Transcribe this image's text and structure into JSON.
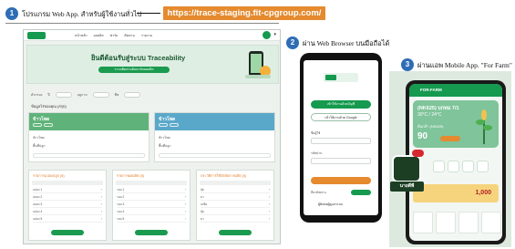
{
  "steps": [
    {
      "number": "1",
      "text": "โปรแกรม Web App. สำหรับผู้ใช้งานทั่วไป"
    },
    {
      "number": "2",
      "text": "ผ่าน Web Browser บนมือถือได้"
    },
    {
      "number": "3",
      "text": "ผ่านแอพ Mobile App. \"For Farm\""
    }
  ],
  "url": "https://trace-staging.fit-cpgroup.com/",
  "desktop": {
    "nav": [
      "หน้าหลัก",
      "ผลผลิต",
      "ฟาร์ม",
      "ติดตาม",
      "รายงาน"
    ],
    "welcome": "ยินดีต้อนรับสู่ระบบ Traceability",
    "banner_button": "ระบบติดตามย้อนกลับผลผลิต",
    "filter_labels": [
      "ตัวกรอง",
      "ปี",
      "ฤดูกาล",
      "พืช"
    ],
    "subtitle": "ข้อมูลไร่ของคุณ (สรุป)",
    "cards": [
      {
        "title": "ข้าวโพด",
        "color": "#5fb37a",
        "line1": "ข้าวโพด",
        "line2": "พื้นที่ปลูก"
      },
      {
        "title": "ข้าวโพด",
        "color": "#5aa8c9",
        "line1": "ข้าวโพด",
        "line2": "พื้นที่ปลูก"
      }
    ],
    "tables": [
      {
        "title": "รายการแปลงปลูก (5)",
        "rows": [
          "แปลง 1",
          "แปลง 2",
          "แปลง 3",
          "แปลง 4",
          "แปลง 5"
        ]
      },
      {
        "title": "รายการผลผลิต (5)",
        "rows": [
          "รอบ 1",
          "รอบ 2",
          "รอบ 3",
          "รอบ 4",
          "รอบ 5"
        ]
      },
      {
        "title": "ประวัติการใช้ปัจจัยการผลิต (5)",
        "rows": [
          "ปุ๋ย",
          "ยา",
          "เมล็ด",
          "ปุ๋ย",
          "ยา"
        ]
      }
    ]
  },
  "phone": {
    "green_button": "เข้าใช้งานด้วยบัญชี",
    "outline_button": "เข้าใช้งานด้วย Google",
    "label_user": "ชื่อผู้ใช้",
    "label_pass": "รหัสผ่าน",
    "link": "ลืมรหัสผ่าน",
    "footer": "ผู้ติดต่อผู้ดูแลระบบ"
  },
  "app": {
    "brand": "FOR-FARM",
    "weather_title": "(NK625) บกทม 7/1",
    "weather_temp": "30°C / 24°C",
    "weather_place": "ต้นกล้า (NK625)",
    "aqi": "90",
    "promo_number": "1,000",
    "buy_label": "นายดีพี"
  }
}
